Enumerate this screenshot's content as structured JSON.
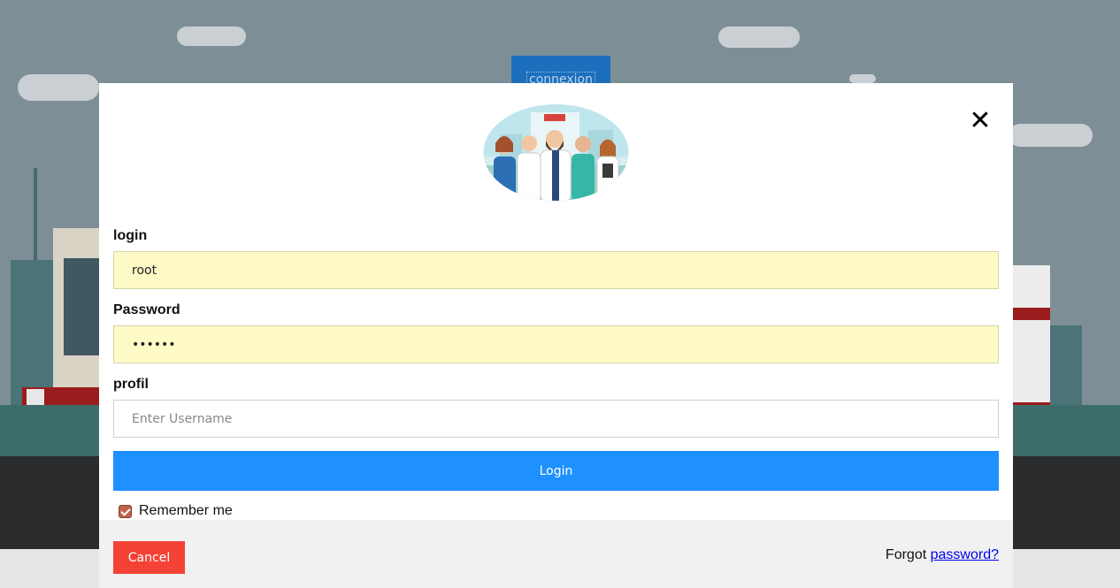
{
  "background": {
    "connexion_label": "connexion"
  },
  "modal": {
    "close_label": "✕",
    "fields": {
      "login_label": "login",
      "login_value": "root",
      "password_label": "Password",
      "password_value": "••••••",
      "profil_label": "profil",
      "profil_placeholder": "Enter Username"
    },
    "login_button": "Login",
    "remember_label": "Remember me",
    "remember_checked": true,
    "footer": {
      "cancel_button": "Cancel",
      "forgot_prefix": "Forgot",
      "forgot_link": "password?"
    }
  },
  "colors": {
    "login_button": "#1e90ff",
    "cancel_button": "#f44336",
    "autofill": "#fefac8",
    "connexion_button": "#1c6fbd"
  }
}
